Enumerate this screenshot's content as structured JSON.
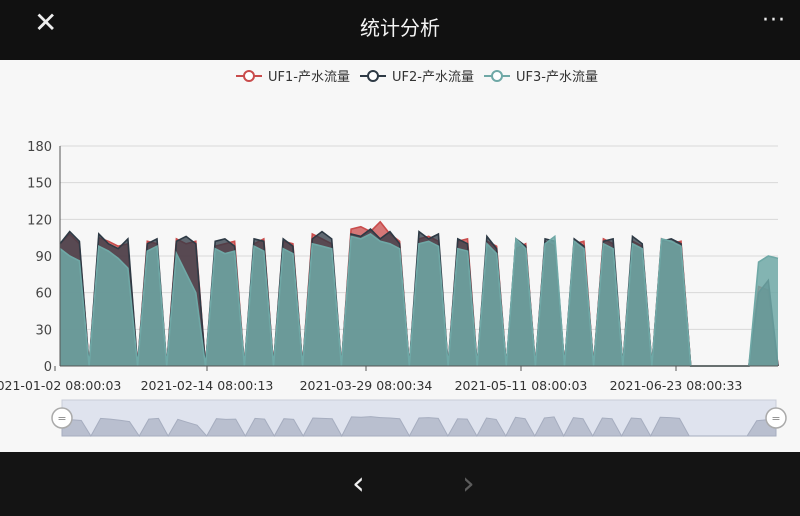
{
  "header": {
    "title": "统计分析",
    "close_icon": "close-icon",
    "more_icon": "more-icon"
  },
  "footer": {
    "prev_icon": "chevron-left-icon",
    "next_icon": "chevron-right-icon"
  },
  "colors": {
    "uf1": "#c94c4c",
    "uf2": "#2e3a45",
    "uf3": "#6fa8a6"
  },
  "chart_data": {
    "type": "area",
    "title": "",
    "xlabel": "",
    "ylabel": "",
    "ylim": [
      0,
      180
    ],
    "yticks": [
      0,
      30,
      60,
      90,
      120,
      150,
      180
    ],
    "grid": true,
    "legend": "top-center",
    "xticks": [
      "2021-01-02 08:00:03",
      "2021-02-14 08:00:13",
      "2021-03-29 08:00:34",
      "2021-05-11 08:00:03",
      "2021-06-23 08:00:33"
    ],
    "x_range": [
      "2021-01-02",
      "2021-07-27"
    ],
    "dataZoom": {
      "start_percent": 0,
      "end_percent": 100
    },
    "series": [
      {
        "name": "UF1-产水流量",
        "values": [
          100,
          108,
          100,
          0,
          105,
          102,
          98,
          100,
          0,
          102,
          100,
          0,
          104,
          100,
          102,
          0,
          98,
          100,
          102,
          0,
          100,
          104,
          0,
          102,
          100,
          0,
          108,
          104,
          100,
          0,
          112,
          114,
          110,
          118,
          108,
          102,
          0,
          104,
          106,
          102,
          0,
          102,
          104,
          0,
          102,
          98,
          0,
          96,
          100,
          0,
          102,
          98,
          0,
          100,
          102,
          0,
          104,
          100,
          0,
          102,
          98,
          0,
          104,
          100,
          102,
          0,
          0,
          0,
          0,
          0,
          0,
          0,
          65,
          62,
          0
        ]
      },
      {
        "name": "UF2-产水流量",
        "values": [
          100,
          110,
          102,
          0,
          108,
          100,
          96,
          104,
          0,
          100,
          104,
          0,
          102,
          106,
          100,
          0,
          102,
          104,
          98,
          0,
          104,
          102,
          0,
          104,
          98,
          0,
          104,
          110,
          104,
          0,
          108,
          106,
          112,
          104,
          110,
          100,
          0,
          110,
          104,
          108,
          0,
          104,
          100,
          0,
          106,
          96,
          0,
          104,
          98,
          0,
          104,
          102,
          0,
          104,
          98,
          0,
          102,
          104,
          0,
          106,
          100,
          0,
          102,
          104,
          100,
          0,
          0,
          0,
          0,
          0,
          0,
          0,
          60,
          70,
          0
        ]
      },
      {
        "name": "UF3-产水流量",
        "values": [
          96,
          90,
          86,
          0,
          98,
          94,
          88,
          80,
          0,
          94,
          98,
          0,
          92,
          76,
          60,
          0,
          96,
          92,
          94,
          0,
          98,
          94,
          0,
          96,
          92,
          0,
          100,
          98,
          96,
          0,
          106,
          104,
          108,
          102,
          100,
          96,
          0,
          100,
          102,
          98,
          0,
          96,
          94,
          0,
          100,
          92,
          0,
          104,
          96,
          0,
          100,
          106,
          0,
          102,
          96,
          0,
          100,
          96,
          0,
          100,
          96,
          0,
          104,
          102,
          98,
          0,
          0,
          0,
          0,
          0,
          0,
          0,
          85,
          90,
          88
        ]
      }
    ]
  }
}
